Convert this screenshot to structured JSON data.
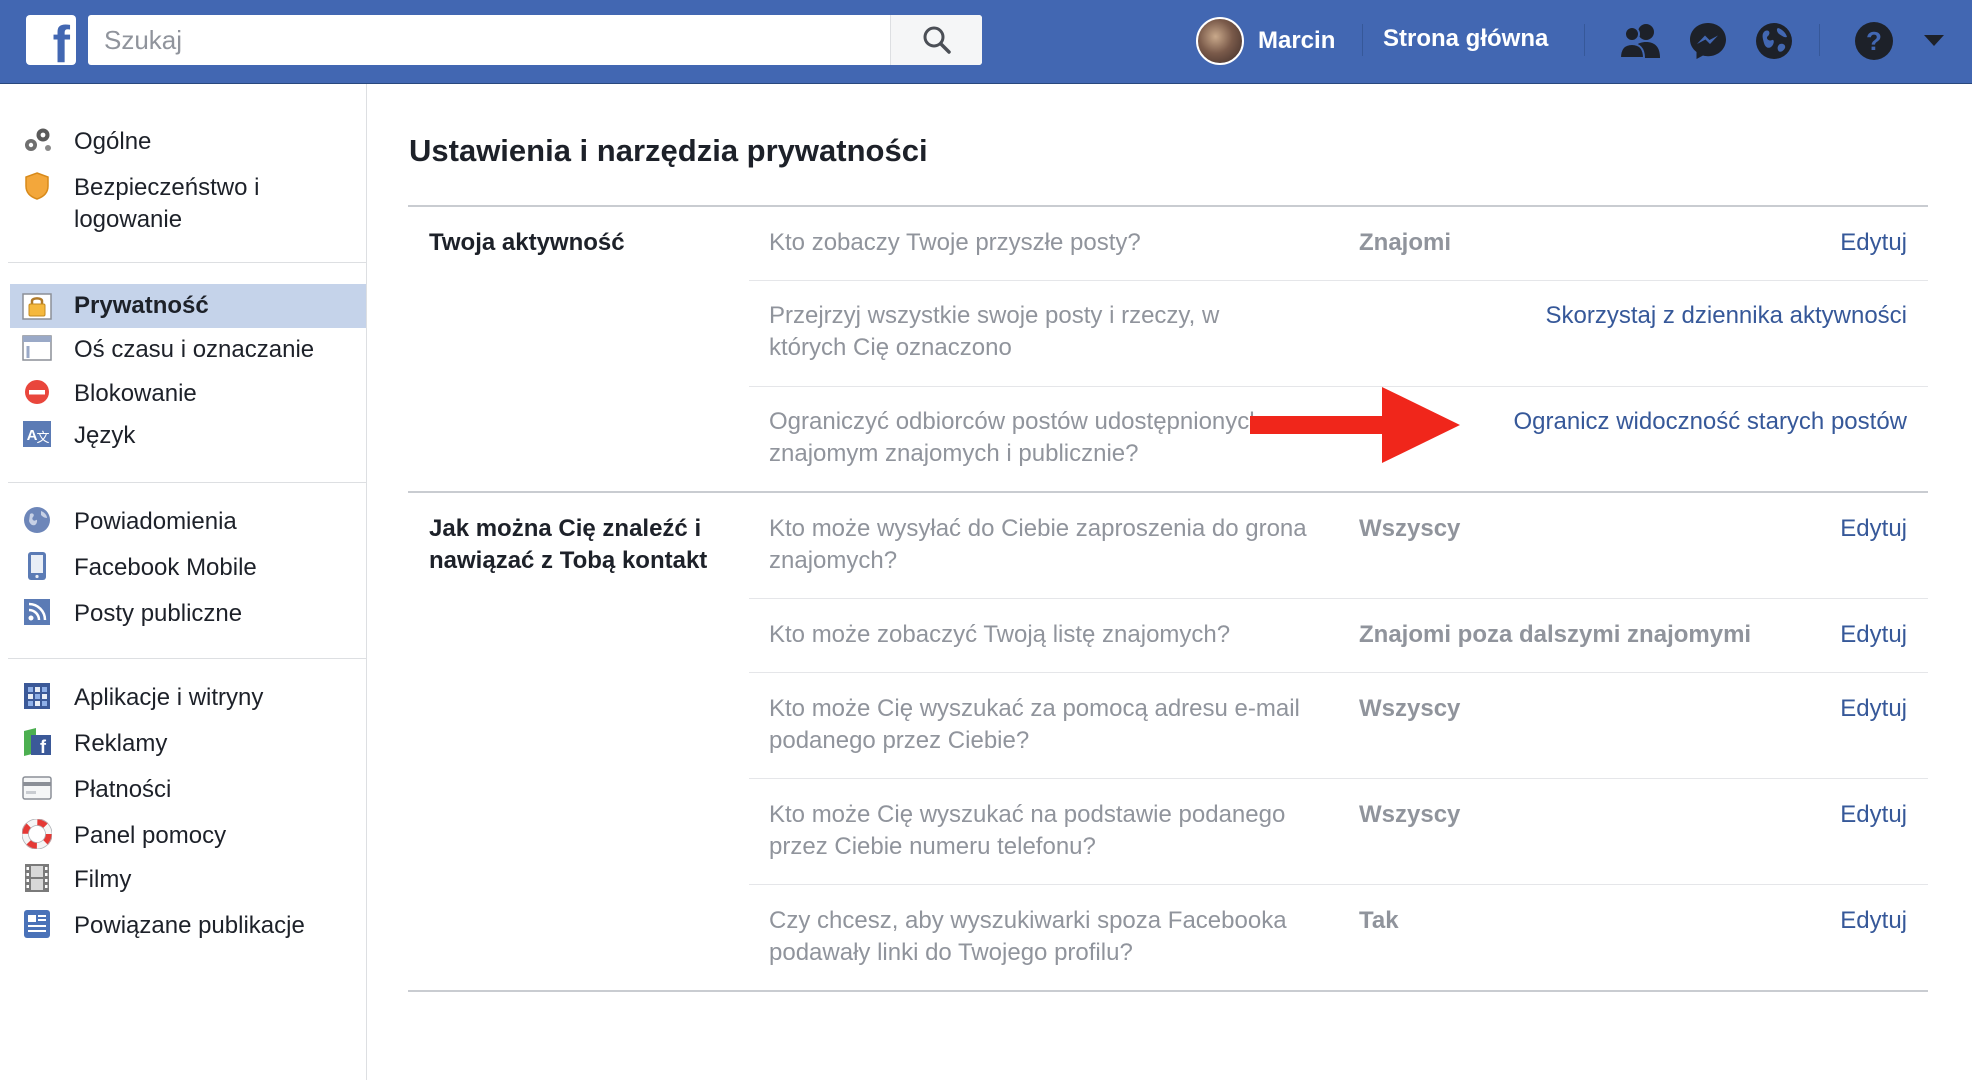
{
  "header": {
    "logo_letter": "f",
    "search_placeholder": "Szukaj",
    "user_name": "Marcin",
    "home_label": "Strona główna"
  },
  "sidebar": {
    "items": [
      {
        "label": "Ogólne",
        "icon": "gears-icon"
      },
      {
        "label": "Bezpieczeństwo i logowanie",
        "icon": "shield-icon"
      },
      {
        "label": "Prywatność",
        "icon": "padlock-icon",
        "active": true
      },
      {
        "label": "Oś czasu i oznaczanie",
        "icon": "timeline-icon"
      },
      {
        "label": "Blokowanie",
        "icon": "block-icon"
      },
      {
        "label": "Język",
        "icon": "language-icon"
      },
      {
        "label": "Powiadomienia",
        "icon": "globe-icon"
      },
      {
        "label": "Facebook Mobile",
        "icon": "mobile-icon"
      },
      {
        "label": "Posty publiczne",
        "icon": "rss-icon"
      },
      {
        "label": "Aplikacje i witryny",
        "icon": "apps-grid-icon"
      },
      {
        "label": "Reklamy",
        "icon": "ads-icon"
      },
      {
        "label": "Płatności",
        "icon": "credit-card-icon"
      },
      {
        "label": "Panel pomocy",
        "icon": "lifebuoy-icon"
      },
      {
        "label": "Filmy",
        "icon": "film-icon"
      },
      {
        "label": "Powiązane publikacje",
        "icon": "publication-icon"
      }
    ]
  },
  "main": {
    "title": "Ustawienia i narzędzia prywatności",
    "sections": [
      {
        "title": "Twoja aktywność",
        "rows": [
          {
            "question": "Kto zobaczy Twoje przyszłe posty?",
            "value": "Znajomi",
            "action": "Edytuj"
          },
          {
            "question": "Przejrzyj wszystkie swoje posty i rzeczy, w których Cię oznaczono",
            "value": "",
            "action": "Skorzystaj z dziennika aktywności"
          },
          {
            "question": "Ograniczyć odbiorców postów udostępnionych znajomym znajomych i publicznie?",
            "value": "",
            "action": "Ogranicz widoczność starych postów"
          }
        ]
      },
      {
        "title": "Jak można Cię znaleźć i nawiązać z Tobą kontakt",
        "rows": [
          {
            "question": "Kto może wysyłać do Ciebie zaproszenia do grona znajomych?",
            "value": "Wszyscy",
            "action": "Edytuj"
          },
          {
            "question": "Kto może zobaczyć Twoją listę znajomych?",
            "value": "Znajomi poza dalszymi znajomymi",
            "action": "Edytuj"
          },
          {
            "question": "Kto może Cię wyszukać za pomocą adresu e-mail podanego przez Ciebie?",
            "value": "Wszyscy",
            "action": "Edytuj"
          },
          {
            "question": "Kto może Cię wyszukać na podstawie podanego przez Ciebie numeru telefonu?",
            "value": "Wszyscy",
            "action": "Edytuj"
          },
          {
            "question": "Czy chcesz, aby wyszukiwarki spoza Facebooka podawały linki do Twojego profilu?",
            "value": "Tak",
            "action": "Edytuj"
          }
        ]
      }
    ]
  },
  "colors": {
    "brand_blue": "#4267b2",
    "link_blue": "#365899",
    "sidebar_active": "#c5d3ea",
    "annotation_arrow": "#f0261b"
  }
}
